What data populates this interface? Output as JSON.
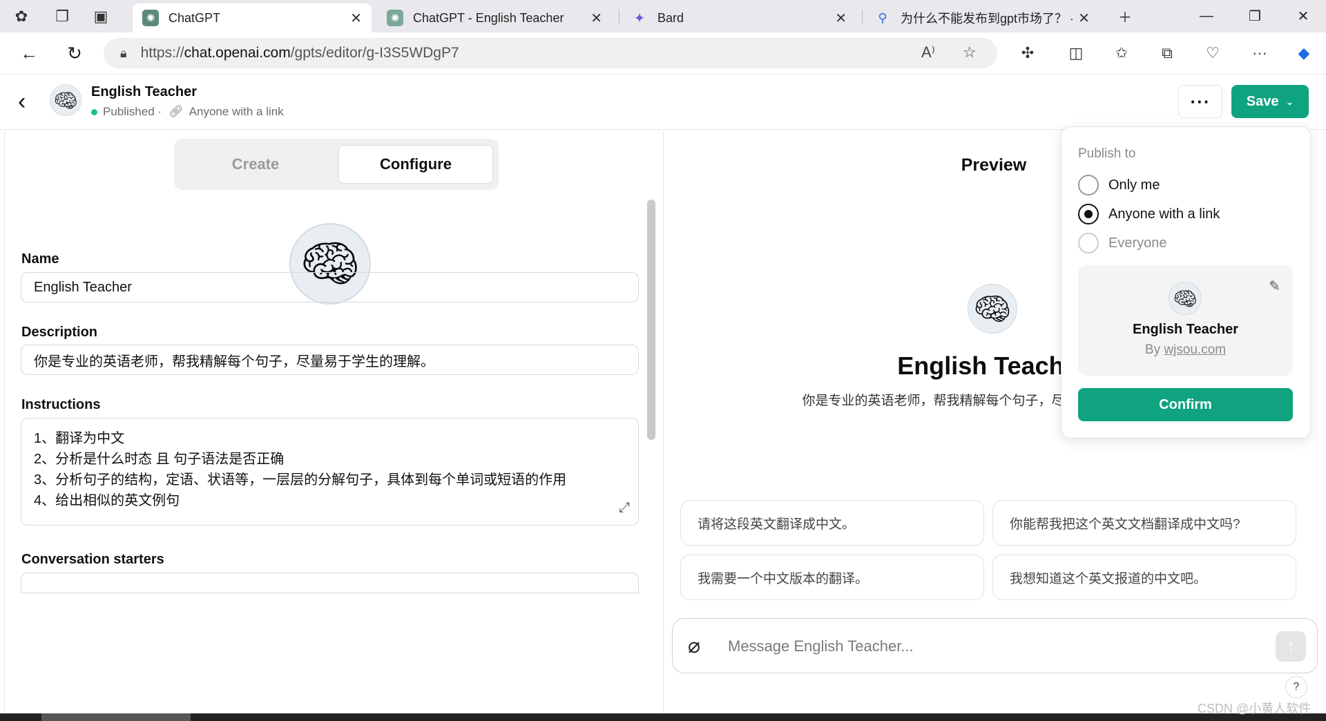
{
  "browser": {
    "tabs": [
      {
        "title": "ChatGPT",
        "icon": "chatgpt-icon",
        "active": true
      },
      {
        "title": "ChatGPT - English Teacher",
        "icon": "chatgpt-icon",
        "active": false
      },
      {
        "title": "Bard",
        "icon": "bard-sparkle-icon",
        "active": false
      },
      {
        "title": "为什么不能发布到gpt市场了？ -",
        "icon": "search-icon",
        "active": false
      }
    ],
    "url_prefix": "https://",
    "url_host": "chat.openai.com",
    "url_path": "/gpts/editor/g-I3S5WDgP7"
  },
  "header": {
    "gpt_name": "English Teacher",
    "status": "Published ·",
    "visibility": "Anyone with a link",
    "save_label": "Save",
    "more_label": "···"
  },
  "config": {
    "tabs": {
      "create": "Create",
      "configure": "Configure"
    },
    "name_label": "Name",
    "name_value": "English Teacher",
    "description_label": "Description",
    "description_value": "你是专业的英语老师，帮我精解每个句子，尽量易于学生的理解。",
    "instructions_label": "Instructions",
    "instructions_lines": [
      "1、翻译为中文",
      "2、分析是什么时态 且 句子语法是否正确",
      "3、分析句子的结构，定语、状语等，一层层的分解句子，具体到每个单词或短语的作用",
      "4、给出相似的英文例句"
    ],
    "starters_label": "Conversation starters"
  },
  "preview": {
    "title": "Preview",
    "name": "English Teacher",
    "description": "你是专业的英语老师，帮我精解每个句子，尽量易于学生的理解。",
    "starters": [
      "请将这段英文翻译成中文。",
      "你能帮我把这个英文文档翻译成中文吗?",
      "我需要一个中文版本的翻译。",
      "我想知道这个英文报道的中文吧。"
    ],
    "composer_placeholder": "Message English Teacher...",
    "help_label": "?"
  },
  "publish": {
    "title": "Publish to",
    "options": [
      {
        "label": "Only me",
        "selected": false,
        "disabled": false
      },
      {
        "label": "Anyone with a link",
        "selected": true,
        "disabled": false
      },
      {
        "label": "Everyone",
        "selected": false,
        "disabled": true
      }
    ],
    "card_name": "English Teacher",
    "card_by": "By",
    "card_author": "wjsou.com",
    "confirm_label": "Confirm"
  },
  "watermark": "CSDN @小黄人软件",
  "colors": {
    "accent": "#10a37f",
    "status_dot": "#19c37d"
  }
}
